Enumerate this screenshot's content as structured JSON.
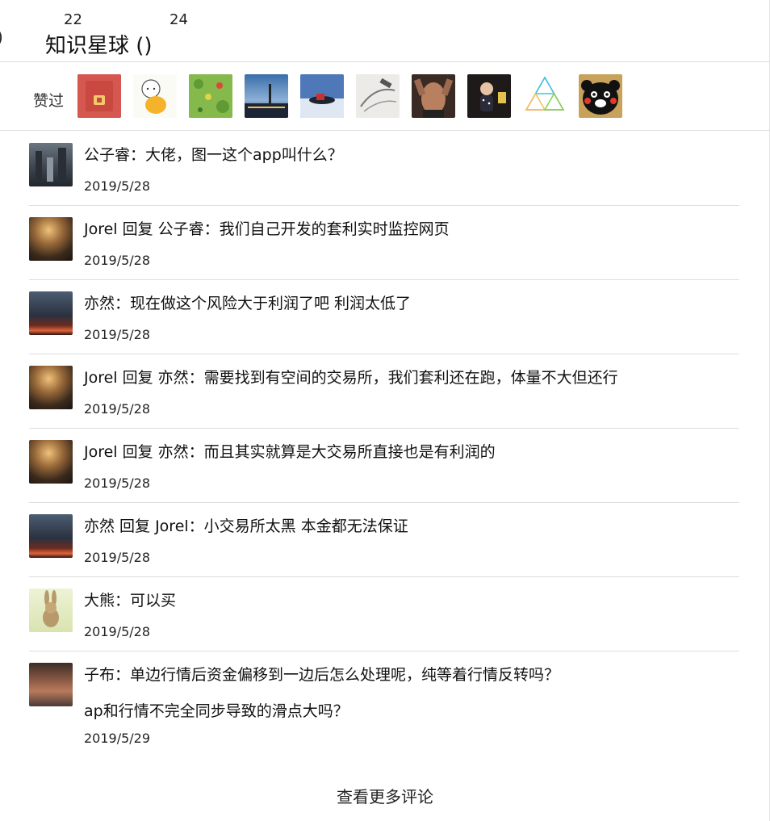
{
  "header": {
    "left_fragment": ")",
    "num_left": "22",
    "num_right": "24",
    "title": "知识星球 ()"
  },
  "likes": {
    "label": "赞过",
    "avatars": [
      {
        "icon": "red-envelope-avatar"
      },
      {
        "icon": "cartoon-monk-avatar"
      },
      {
        "icon": "game-map-avatar"
      },
      {
        "icon": "city-night-avatar"
      },
      {
        "icon": "snowmobile-avatar"
      },
      {
        "icon": "sketch-avatar"
      },
      {
        "icon": "muscle-back-avatar"
      },
      {
        "icon": "girl-avatar"
      },
      {
        "icon": "triangle-avatar"
      },
      {
        "icon": "kumamon-avatar"
      }
    ]
  },
  "comments": [
    {
      "text": "公子睿：大佬，图一这个app叫什么？",
      "date": "2019/5/28"
    },
    {
      "text": "Jorel 回复 公子睿：我们自己开发的套利实时监控网页",
      "date": "2019/5/28"
    },
    {
      "text": "亦然：现在做这个风险大于利润了吧 利润太低了",
      "date": "2019/5/28"
    },
    {
      "text": "Jorel 回复 亦然：需要找到有空间的交易所，我们套利还在跑，体量不大但还行",
      "date": "2019/5/28"
    },
    {
      "text": "Jorel 回复 亦然：而且其实就算是大交易所直接也是有利润的",
      "date": "2019/5/28"
    },
    {
      "text": "亦然 回复 Jorel：小交易所太黑  本金都无法保证",
      "date": "2019/5/28"
    },
    {
      "text": "大熊：可以买",
      "date": "2019/5/28"
    },
    {
      "text": "子布：单边行情后资金偏移到一边后怎么处理呢，纯等着行情反转吗？",
      "text2": "ap和行情不完全同步导致的滑点大吗？",
      "date": "2019/5/29"
    }
  ],
  "more_label": "查看更多评论"
}
